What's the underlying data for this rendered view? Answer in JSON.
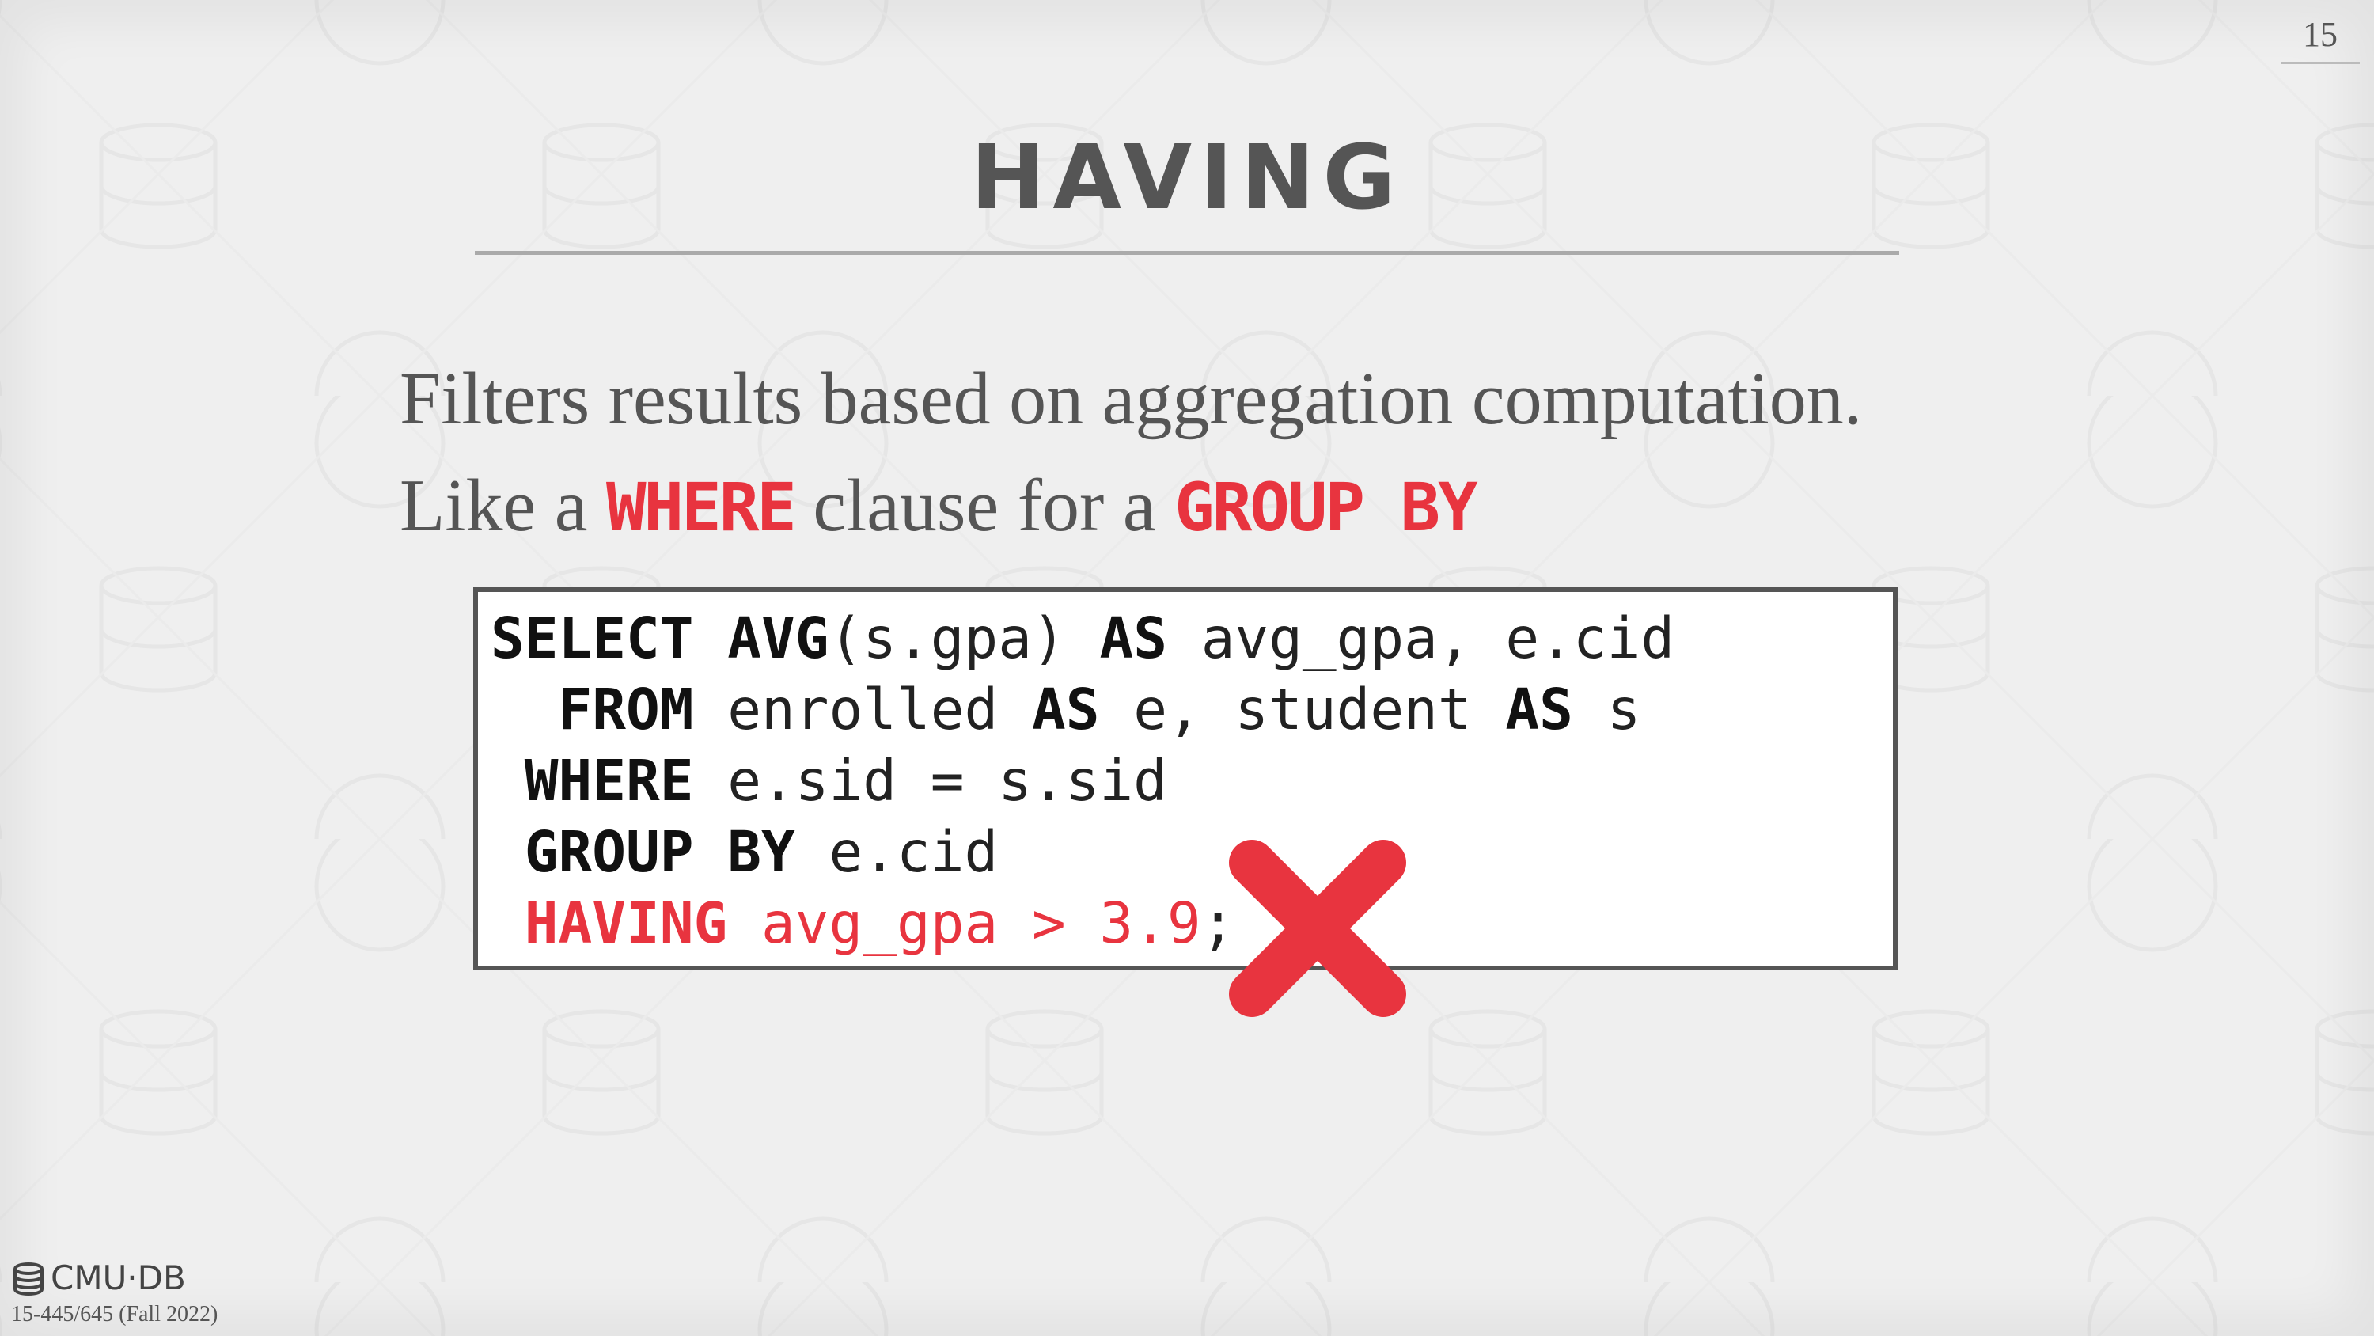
{
  "slide": {
    "page_number": "15",
    "title": "HAVING",
    "bullet1": "Filters results based on aggregation computation.",
    "bullet2": {
      "prefix": "Like a ",
      "kw1": "WHERE",
      "mid": " clause for a ",
      "kw2": "GROUP BY"
    }
  },
  "code": {
    "line1": {
      "kw1": "SELECT",
      "kw2": "AVG",
      "t1": "(s.gpa) ",
      "kw3": "AS",
      "t2": " avg_gpa, e.cid"
    },
    "line2": {
      "indent": "  ",
      "kw1": "FROM",
      "t1": " enrolled ",
      "kw2": "AS",
      "t2": " e, student ",
      "kw3": "AS",
      "t3": " s"
    },
    "line3": {
      "indent": " ",
      "kw1": "WHERE",
      "t1": " e.sid = s.sid"
    },
    "line4": {
      "indent": " ",
      "kw1": "GROUP",
      "t1": " ",
      "kw2": "BY",
      "t2": " e.cid"
    },
    "line5": {
      "indent": " ",
      "kw1": "HAVING",
      "t1": " avg_gpa > 3.9",
      "t2": ";"
    }
  },
  "footer": {
    "brand": "CMU·DB",
    "course": "15-445/645 (Fall 2022)"
  },
  "icons": {
    "invalid": "x-mark-icon",
    "logo": "database-stack-icon"
  },
  "colors": {
    "accent_red": "#e8343f",
    "title_gray": "#555555"
  }
}
